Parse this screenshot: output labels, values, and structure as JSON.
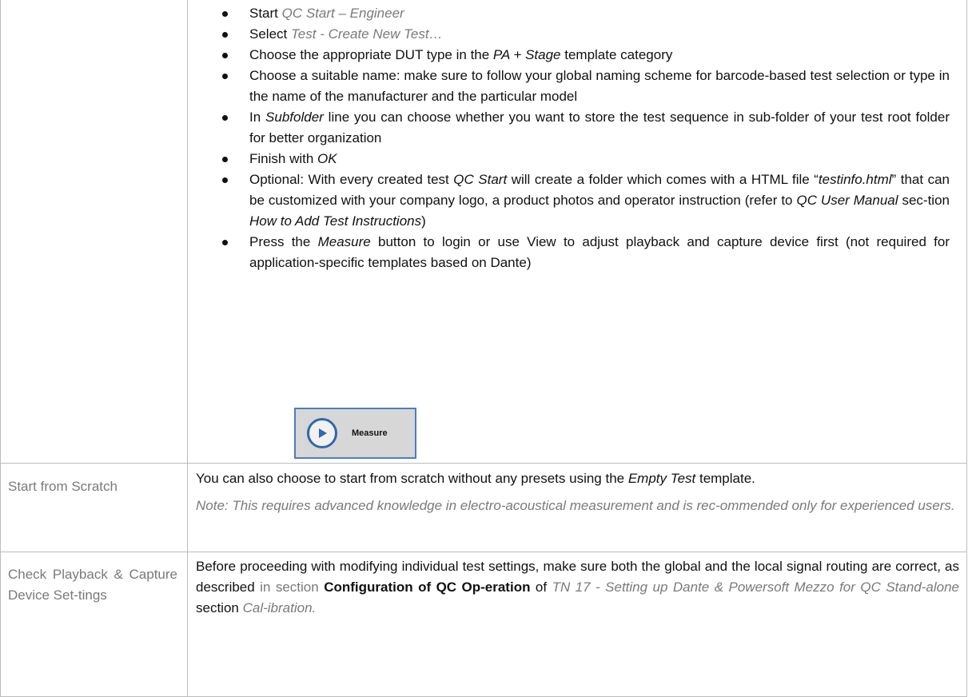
{
  "steps": [
    {
      "parts": [
        {
          "t": "Start ",
          "c": ""
        },
        {
          "t": "QC Start – Engineer",
          "c": "grey it"
        }
      ]
    },
    {
      "parts": [
        {
          "t": "Select ",
          "c": ""
        },
        {
          "t": "Test - Create New Test…",
          "c": "grey it"
        }
      ]
    },
    {
      "parts": [
        {
          "t": "Choose the appropriate DUT type in the ",
          "c": ""
        },
        {
          "t": "PA + Stage",
          "c": "it"
        },
        {
          "t": " template category",
          "c": ""
        }
      ]
    },
    {
      "parts": [
        {
          "t": "Choose a suitable name: make sure to follow your global naming scheme for barcode-based test selection or type in the name of the manufacturer and the particular model",
          "c": ""
        }
      ]
    },
    {
      "parts": [
        {
          "t": "In ",
          "c": ""
        },
        {
          "t": "Subfolder",
          "c": "it"
        },
        {
          "t": " line you can choose whether you want to store the test sequence in sub-folder of your test root folder for better organization",
          "c": ""
        }
      ]
    },
    {
      "parts": [
        {
          "t": "Finish with ",
          "c": ""
        },
        {
          "t": "OK",
          "c": "it"
        }
      ]
    },
    {
      "parts": [
        {
          "t": "Optional: With every created test ",
          "c": ""
        },
        {
          "t": "QC Start",
          "c": "it"
        },
        {
          "t": " will create a folder which comes with a HTML file “",
          "c": ""
        },
        {
          "t": "testinfo.html",
          "c": "it"
        },
        {
          "t": "” that can be customized with your company logo, a product photos and operator instruction (refer to ",
          "c": ""
        },
        {
          "t": "QC User Manual",
          "c": "it"
        },
        {
          "t": " sec-tion ",
          "c": ""
        },
        {
          "t": "How to Add Test Instructions",
          "c": "it"
        },
        {
          "t": ")",
          "c": ""
        }
      ]
    },
    {
      "parts": [
        {
          "t": "Press the ",
          "c": ""
        },
        {
          "t": "Measure",
          "c": "it"
        },
        {
          "t": " button to login or use View to adjust playback and capture device first (not required for application-specific templates based on Dante)",
          "c": ""
        }
      ]
    }
  ],
  "measure_button": {
    "label": "Measure",
    "icon": "play-icon"
  },
  "rows": {
    "scratch": {
      "label": "Start from Scratch",
      "body": [
        {
          "t": "You can also choose to start from scratch without any presets using the ",
          "c": ""
        },
        {
          "t": "Empty Test",
          "c": "it"
        },
        {
          "t": " template.",
          "c": ""
        }
      ],
      "note": "Note: This requires advanced knowledge in electro-acoustical measurement and is rec-ommended only for experienced users."
    },
    "playback": {
      "label": "Check Playback & Capture Device Set-tings",
      "body": [
        {
          "t": "Before proceeding with modifying individual test settings, make sure both the global and the local signal routing are correct, as described ",
          "c": ""
        },
        {
          "t": "in section ",
          "c": "grey"
        },
        {
          "t": "Configuration of QC Op-eration",
          "c": "bold"
        },
        {
          "t": " of ",
          "c": ""
        },
        {
          "t": "TN 17 - Setting up Dante & Powersoft Mezzo for QC Stand-alone",
          "c": "grey it"
        },
        {
          "t": " section ",
          "c": ""
        },
        {
          "t": "Cal-ibration.",
          "c": "grey it"
        }
      ]
    }
  },
  "colors": {
    "grid": "#bdbdbd",
    "accent_blue": "#2f67b0",
    "grey_text": "#7a7a7a"
  }
}
